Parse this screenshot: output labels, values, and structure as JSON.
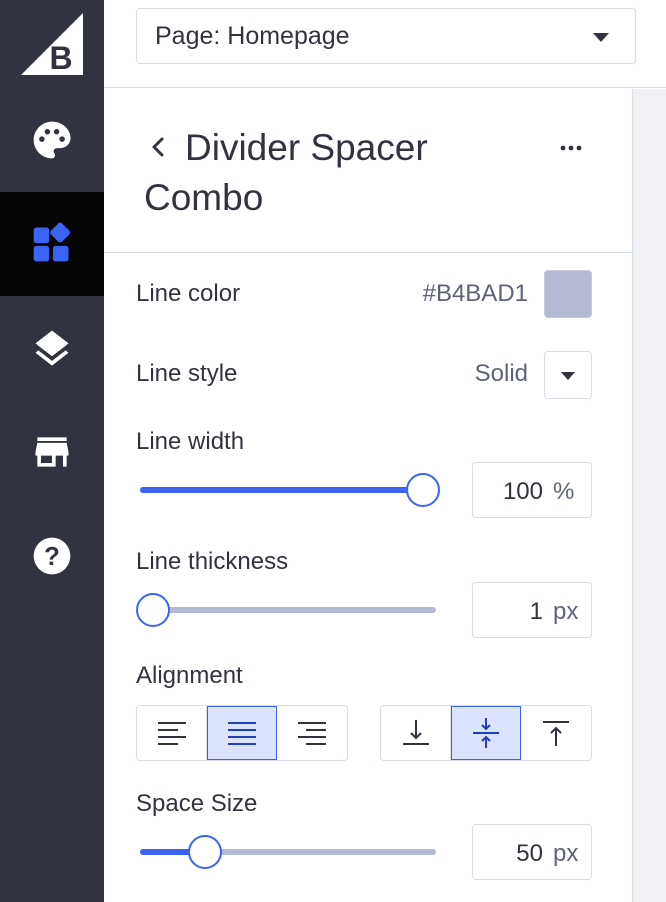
{
  "topbar": {
    "page_select_value": "Page: Homepage"
  },
  "sidebar": {
    "items": [
      {
        "name": "theme-styles",
        "icon": "palette-icon"
      },
      {
        "name": "page-builder",
        "icon": "widgets-icon",
        "active": true
      },
      {
        "name": "layers",
        "icon": "layers-icon"
      },
      {
        "name": "storefront",
        "icon": "store-icon"
      },
      {
        "name": "help",
        "icon": "help-icon"
      }
    ]
  },
  "panel": {
    "title": "Divider Spacer Combo",
    "line_color": {
      "label": "Line color",
      "value": "#B4BAD1"
    },
    "line_style": {
      "label": "Line style",
      "value": "Solid"
    },
    "line_width": {
      "label": "Line width",
      "value": "100",
      "unit": "%",
      "slider_fraction": 1.0
    },
    "line_thickness": {
      "label": "Line thickness",
      "value": "1",
      "unit": "px",
      "slider_fraction": 0.0
    },
    "alignment": {
      "label": "Alignment",
      "horizontal_options": [
        "left",
        "center",
        "right"
      ],
      "horizontal_selected": "center",
      "vertical_options": [
        "bottom",
        "middle",
        "top"
      ],
      "vertical_selected": "middle"
    },
    "space_size": {
      "label": "Space Size",
      "value": "50",
      "unit": "px",
      "slider_fraction": 0.22
    }
  },
  "colors": {
    "accent": "#3C64F4",
    "sidebar_bg": "#313440",
    "line_color_swatch": "#B4BAD1"
  }
}
